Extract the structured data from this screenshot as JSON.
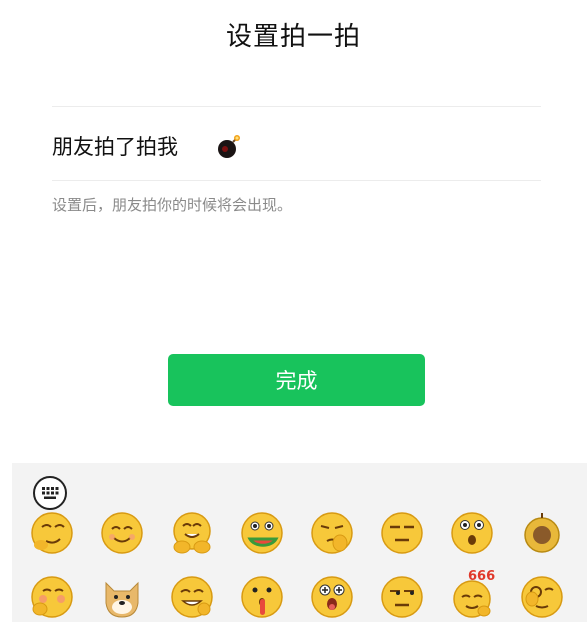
{
  "header": {
    "title": "设置拍一拍"
  },
  "setting": {
    "label": "朋友拍了拍我",
    "icon": "bomb-icon"
  },
  "hint": "设置后，朋友拍你的时候将会出现。",
  "done_button": {
    "label": "完成",
    "color": "#18c35c"
  },
  "emoji_panel": {
    "keyboard_icon": "keyboard-icon",
    "row1": [
      "smirk-icon",
      "smile-icon",
      "clap-icon",
      "eating-watermelon-icon",
      "facepalm-icon",
      "unamused-icon",
      "surprised-icon",
      "bomb-icon"
    ],
    "row2": [
      "shy-icon",
      "doge-icon",
      "grin-icon",
      "shh-icon",
      "drool-icon",
      "sidelong-icon",
      "666-icon",
      "ok-icon"
    ],
    "badge_text": "666"
  }
}
